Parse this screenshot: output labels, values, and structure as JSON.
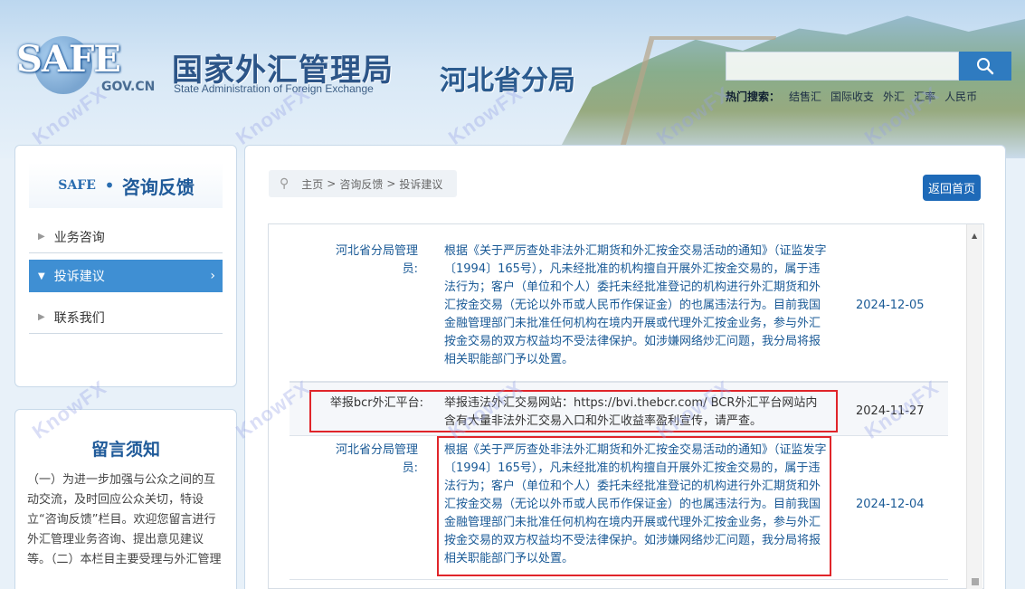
{
  "header": {
    "logo_text": "SAFE",
    "logo_domain": "GOV.CN",
    "agency_cn": "国家外汇管理局",
    "agency_en": "State Administration of Foreign Exchange",
    "branch": "河北省分局",
    "search_placeholder": "",
    "hot_label": "热门搜索：",
    "hot_terms": [
      "结售汇",
      "国际收支",
      "外汇",
      "汇率",
      "人民币"
    ]
  },
  "sidebar": {
    "logo_text": "SAFE",
    "title": "咨询反馈",
    "items": [
      {
        "label": "业务咨询"
      },
      {
        "label": "投诉建议"
      },
      {
        "label": "联系我们"
      }
    ]
  },
  "notice": {
    "title": "留言须知",
    "text": "（一）为进一步加强与公众之间的互动交流，及时回应公众关切，特设立“咨询反馈”栏目。欢迎您留言进行外汇管理业务咨询、提出意见建议等。（二）本栏目主要受理与外汇管理"
  },
  "breadcrumb": {
    "home": "主页",
    "sep": ">",
    "level1": "咨询反馈",
    "level2": "投诉建议"
  },
  "back_button": "返回首页",
  "entries": [
    {
      "label": "河北省分局管理员:",
      "body": "根据《关于严厉查处非法外汇期货和外汇按金交易活动的通知》（证监发字〔1994〕165号），凡未经批准的机构擅自开展外汇按金交易的，属于违法行为；客户（单位和个人）委托未经批准登记的机构进行外汇期货和外汇按金交易（无论以外币或人民币作保证金）的也属违法行为。目前我国金融管理部门未批准任何机构在境内开展或代理外汇按金业务，参与外汇按金交易的双方权益均不受法律保护。如涉嫌网络炒汇问题，我分局将报相关职能部门予以处置。",
      "date": "2024-12-05"
    },
    {
      "label": "举报bcr外汇平台:",
      "body": "举报违法外汇交易网站：https://bvi.thebcr.com/ BCR外汇平台网站内含有大量非法外汇交易入口和外汇收益率盈利宣传，请严查。",
      "date": "2024-11-27"
    },
    {
      "label": "河北省分局管理员:",
      "body": "根据《关于严厉查处非法外汇期货和外汇按金交易活动的通知》（证监发字〔1994〕165号），凡未经批准的机构擅自开展外汇按金交易的，属于违法行为；客户（单位和个人）委托未经批准登记的机构进行外汇期货和外汇按金交易（无论以外币或人民币作保证金）的也属违法行为。目前我国金融管理部门未批准任何机构在境内开展或代理外汇按金业务，参与外汇按金交易的双方权益均不受法律保护。如涉嫌网络炒汇问题，我分局将报相关职能部门予以处置。",
      "date": "2024-12-04"
    }
  ],
  "watermark": "KnowFX",
  "colors": {
    "accent": "#1e6ab8",
    "menu_active": "#3f8fd3",
    "reply_text": "#1a5a96",
    "highlight_border": "#e0252a"
  }
}
